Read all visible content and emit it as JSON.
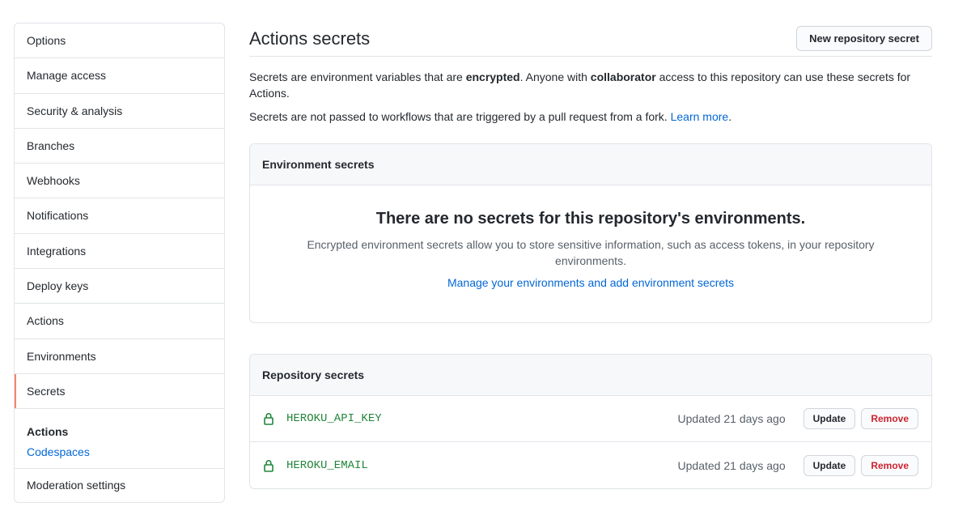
{
  "sidebar": {
    "items": [
      {
        "label": "Options"
      },
      {
        "label": "Manage access"
      },
      {
        "label": "Security & analysis"
      },
      {
        "label": "Branches"
      },
      {
        "label": "Webhooks"
      },
      {
        "label": "Notifications"
      },
      {
        "label": "Integrations"
      },
      {
        "label": "Deploy keys"
      },
      {
        "label": "Actions"
      },
      {
        "label": "Environments"
      },
      {
        "label": "Secrets",
        "selected": true
      }
    ],
    "group_heading": "Actions",
    "group_link": "Codespaces",
    "last_item": "Moderation settings"
  },
  "main": {
    "title": "Actions secrets",
    "new_button": "New repository secret",
    "desc1_a": "Secrets are environment variables that are ",
    "desc1_b": "encrypted",
    "desc1_c": ". Anyone with ",
    "desc1_d": "collaborator",
    "desc1_e": " access to this repository can use these secrets for Actions.",
    "desc2_a": "Secrets are not passed to workflows that are triggered by a pull request from a fork. ",
    "desc2_link": "Learn more",
    "desc2_end": "."
  },
  "env_box": {
    "heading": "Environment secrets",
    "blank_title": "There are no secrets for this repository's environments.",
    "blank_text": "Encrypted environment secrets allow you to store sensitive information, such as access tokens, in your repository environments.",
    "blank_link": "Manage your environments and add environment secrets"
  },
  "repo_box": {
    "heading": "Repository secrets",
    "secrets": [
      {
        "name": "HEROKU_API_KEY",
        "updated": "Updated 21 days ago",
        "update_label": "Update",
        "remove_label": "Remove"
      },
      {
        "name": "HEROKU_EMAIL",
        "updated": "Updated 21 days ago",
        "update_label": "Update",
        "remove_label": "Remove"
      }
    ]
  },
  "icons": {
    "secret": "lock-icon"
  },
  "colors": {
    "accent_selected": "#f9826c",
    "link": "#0366d6",
    "secret_name": "#22863a",
    "danger": "#cb2431"
  }
}
